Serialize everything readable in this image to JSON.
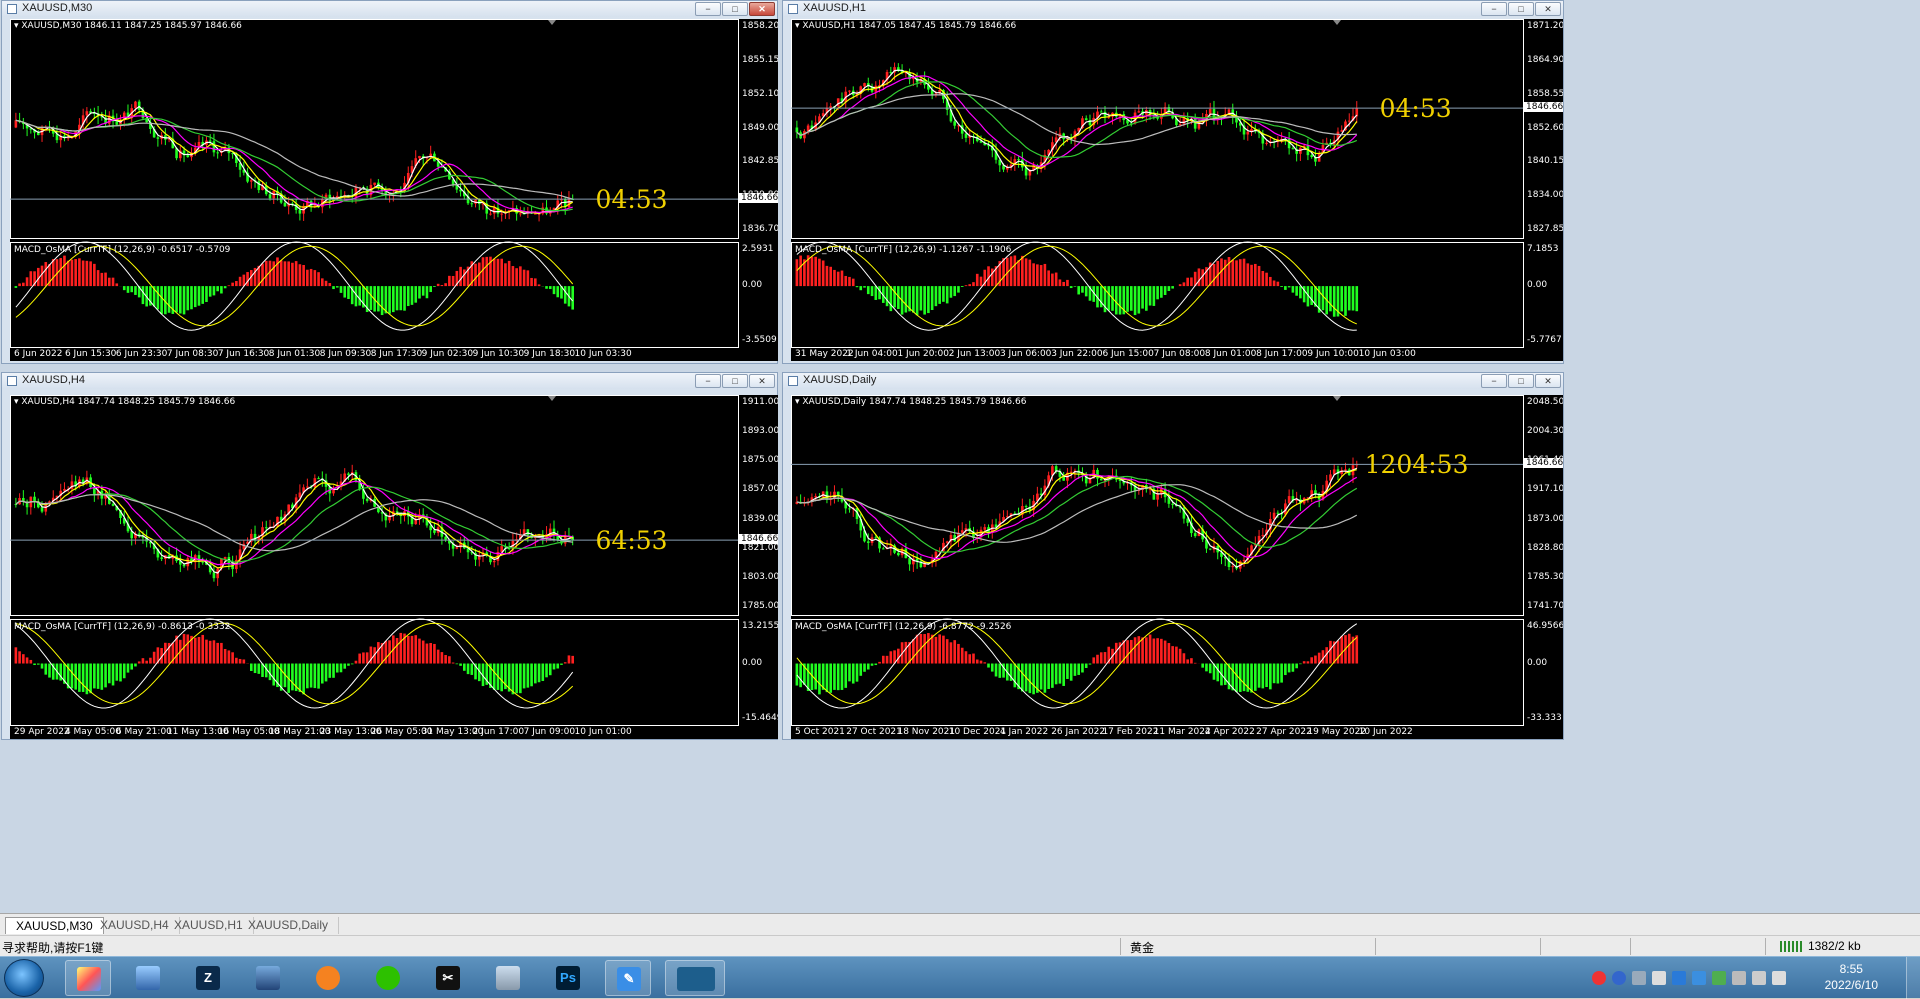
{
  "windows": [
    {
      "id": "m30",
      "title": "XAUUSD,M30",
      "symbol_info": "XAUUSD,M30  1846.11 1847.25 1845.97 1846.66",
      "indicator_info": "MACD_OsMA [CurrTF] (12,26,9) -0.6517 -0.5709",
      "countdown": "04:53",
      "current_price": "1846.66",
      "price_axis": [
        "1858.20",
        "1855.15",
        "1852.10",
        "1849.00",
        "1842.85",
        "1839.80",
        "1836.70"
      ],
      "indicator_axis": [
        "2.5931",
        "0.00",
        "-3.5509"
      ],
      "time_axis": [
        "6 Jun 2022",
        "6 Jun 15:30",
        "6 Jun 23:30",
        "7 Jun 08:30",
        "7 Jun 16:30",
        "8 Jun 01:30",
        "8 Jun 09:30",
        "8 Jun 17:30",
        "9 Jun 02:30",
        "9 Jun 10:30",
        "9 Jun 18:30",
        "10 Jun 03:30"
      ]
    },
    {
      "id": "h1",
      "title": "XAUUSD,H1",
      "symbol_info": "XAUUSD,H1  1847.05 1847.45 1845.79 1846.66",
      "indicator_info": "MACD_OsMA [CurrTF] (12,26,9) -1.1267 -1.1906",
      "countdown": "04:53",
      "current_price": "1846.66",
      "price_axis": [
        "1871.20",
        "1864.90",
        "1858.55",
        "1852.60",
        "1840.15",
        "1834.00",
        "1827.85"
      ],
      "indicator_axis": [
        "7.1853",
        "0.00",
        "-5.7767"
      ],
      "time_axis": [
        "31 May 2022",
        "1 Jun 04:00",
        "1 Jun 20:00",
        "2 Jun 13:00",
        "3 Jun 06:00",
        "3 Jun 22:00",
        "6 Jun 15:00",
        "7 Jun 08:00",
        "8 Jun 01:00",
        "8 Jun 17:00",
        "9 Jun 10:00",
        "10 Jun 03:00"
      ]
    },
    {
      "id": "h4",
      "title": "XAUUSD,H4",
      "symbol_info": "XAUUSD,H4  1847.74 1848.25 1845.79 1846.66",
      "indicator_info": "MACD_OsMA [CurrTF] (12,26,9) -0.8613 -0.3332",
      "countdown": "64:53",
      "current_price": "1846.66",
      "price_axis": [
        "1911.00",
        "1893.00",
        "1875.00",
        "1857.00",
        "1839.00",
        "1821.00",
        "1803.00",
        "1785.00"
      ],
      "indicator_axis": [
        "13.2155",
        "0.00",
        "-15.4649"
      ],
      "time_axis": [
        "29 Apr 2022",
        "4 May 05:00",
        "6 May 21:00",
        "11 May 13:00",
        "16 May 05:00",
        "18 May 21:00",
        "23 May 13:00",
        "26 May 05:00",
        "31 May 13:00",
        "2 Jun 17:00",
        "7 Jun 09:00",
        "10 Jun 01:00"
      ]
    },
    {
      "id": "daily",
      "title": "XAUUSD,Daily",
      "symbol_info": "XAUUSD,Daily  1847.74 1848.25 1845.79 1846.66",
      "indicator_info": "MACD_OsMA [CurrTF] (12,26,9) -6.8772 -9.2526",
      "countdown": "1204:53",
      "current_price": "1846.66",
      "price_axis": [
        "2048.50",
        "2004.30",
        "1961.40",
        "1917.10",
        "1873.00",
        "1828.80",
        "1785.30",
        "1741.70"
      ],
      "indicator_axis": [
        "46.9566",
        "0.00",
        "-33.333"
      ],
      "time_axis": [
        "5 Oct 2021",
        "27 Oct 2021",
        "18 Nov 2021",
        "10 Dec 2021",
        "4 Jan 2022",
        "26 Jan 2022",
        "17 Feb 2022",
        "11 Mar 2022",
        "4 Apr 2022",
        "27 Apr 2022",
        "19 May 2022",
        "10 Jun 2022"
      ]
    }
  ],
  "window_buttons": {
    "minimize": "−",
    "maximize": "□",
    "close": "✕"
  },
  "tabs": [
    "XAUUSD,M30",
    "XAUUSD,H4",
    "XAUUSD,H1",
    "XAUUSD,Daily"
  ],
  "status": {
    "help": "寻求帮助,请按F1键",
    "symbol_name": "黄金",
    "traffic": "1382/2 kb"
  },
  "taskbar": {
    "time": "8:55",
    "date": "2022/6/10"
  },
  "colors": {
    "bull": "#ff2020",
    "bear": "#20ff20",
    "ma_fast": "#ffffff",
    "ma_yellow": "#ffff00",
    "ma_magenta": "#ff00ff",
    "ma_green": "#33cc33",
    "ma_gray": "#bbbbbb",
    "countdown": "#f0d000"
  }
}
